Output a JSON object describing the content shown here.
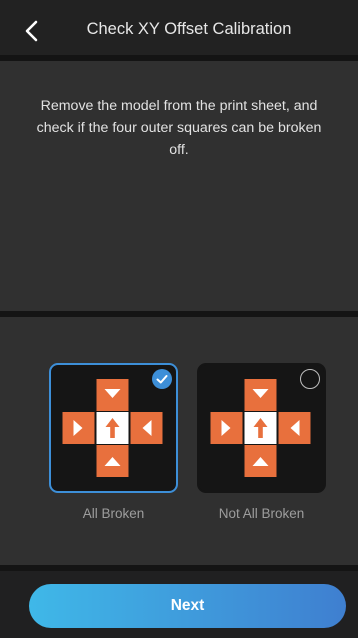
{
  "header": {
    "title": "Check XY Offset Calibration",
    "back_icon": "chevron-left-icon"
  },
  "instruction": "Remove the model from the print sheet, and check if the four outer squares can be broken off.",
  "options": [
    {
      "label": "All Broken",
      "selected": true,
      "icon": "checkmark-icon"
    },
    {
      "label": "Not All Broken",
      "selected": false,
      "icon": "empty-radio-icon"
    }
  ],
  "next_button": {
    "label": "Next"
  },
  "colors": {
    "accent": "#3d8fd8",
    "tile_orange": "#e8703d",
    "button_start": "#3fb8e8",
    "button_end": "#3f7fd0"
  }
}
